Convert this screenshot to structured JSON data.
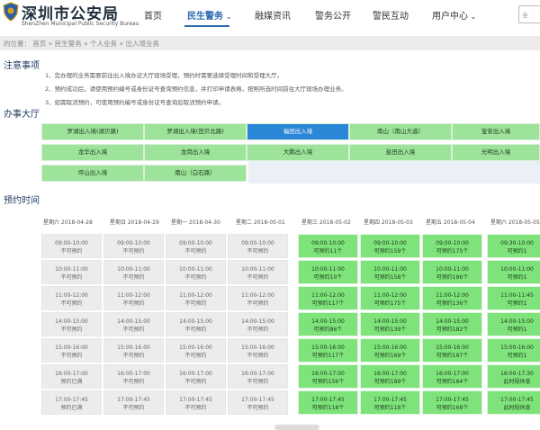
{
  "header": {
    "title": "深圳市公安局",
    "subtitle": "ShenZhen Municipal Public Security Bureau",
    "nav": [
      "首页",
      "民生警务",
      "融媒资讯",
      "警务公开",
      "警民互动",
      "用户中心"
    ],
    "active_nav": "民生警务",
    "search_placeholder": "全"
  },
  "breadcrumb": "的位置： 首页 » 民生警务 » 个人业务 » 出入境业务",
  "notice": {
    "title": "注意事项",
    "items": [
      "1、您办理的业务需要前往出入境办证大厅现场受理，预约时需要选择受理时间和受理大厅。",
      "2、预约成功后，请使用预约编号或身份证号查询预约信息，并打印申请表格，按照所选时间前往大厅现场办理业务。",
      "3、如需取消预约，可使用预约编号或身份证号查询后取消预约申请。"
    ]
  },
  "halls": {
    "title": "办事大厅",
    "items": [
      "罗湖出入境(湖贝路)",
      "罗湖出入境(田贝北路)",
      "福田出入境",
      "南山（南山大道）",
      "宝安出入境",
      "龙华出入境",
      "龙岗出入境",
      "大鹏出入境",
      "盐田出入境",
      "光明出入境",
      "坪山出入境",
      "南山（白石路）"
    ],
    "active": "福田出入境"
  },
  "schedule": {
    "title": "预约时间",
    "days": [
      "星期六 2018-04-28",
      "星期日 2018-04-29",
      "星期一 2018-04-30",
      "星期二 2018-05-01",
      "星期三 2018-05-02",
      "星期四 2018-05-03",
      "星期五 2018-05-04",
      "星期六 2018-05-05"
    ],
    "rows": [
      {
        "time_a": "09:00-10:00",
        "time_b": "09:30-10:00",
        "status": [
          "不可预约",
          "不可预约",
          "不可预约",
          "不可预约",
          "可预约11个",
          "可预约159个",
          "可预约175个",
          "可预约1"
        ]
      },
      {
        "time_a": "10:00-11:00",
        "time_b": "10:00-11:00",
        "status": [
          "不可预约",
          "不可预约",
          "不可预约",
          "不可预约",
          "可预约10个",
          "可预约158个",
          "可预约186个",
          "可预约1"
        ]
      },
      {
        "time_a": "11:00-12:00",
        "time_b": "11:00-11:45",
        "status": [
          "不可预约",
          "不可预约",
          "不可预约",
          "不可预约",
          "可预约117个",
          "可预约175个",
          "可预约136个",
          "可预约1"
        ]
      },
      {
        "time_a": "14:00-15:00",
        "time_b": "14:00-15:00",
        "status": [
          "不可预约",
          "不可预约",
          "不可预约",
          "不可预约",
          "可预约86个",
          "可预约139个",
          "可预约182个",
          "可预约1"
        ]
      },
      {
        "time_a": "15:00-16:00",
        "time_b": "15:00-16:00",
        "status": [
          "不可预约",
          "不可预约",
          "不可预约",
          "不可预约",
          "可预约117个",
          "可预约169个",
          "可预约187个",
          "可预约1"
        ]
      },
      {
        "time_a": "16:00-17:00",
        "time_b": "16:00-17:30",
        "status": [
          "预约已满",
          "不可预约",
          "不可预约",
          "不可预约",
          "可预约156个",
          "可预约189个",
          "可预约184个",
          "此时段休息"
        ]
      },
      {
        "time_a": "17:00-17:45",
        "time_b": "17:00-17:45",
        "status": [
          "预约已满",
          "不可预约",
          "不可预约",
          "不可预约",
          "可预约118个",
          "可预约118个",
          "可预约168个",
          "此时段休息"
        ]
      }
    ]
  },
  "colors": {
    "accent": "#2a6bb0",
    "available": "#7ee37a",
    "hall": "#9de39a",
    "active_hall": "#2a86d6",
    "unavailable": "#ececec"
  }
}
